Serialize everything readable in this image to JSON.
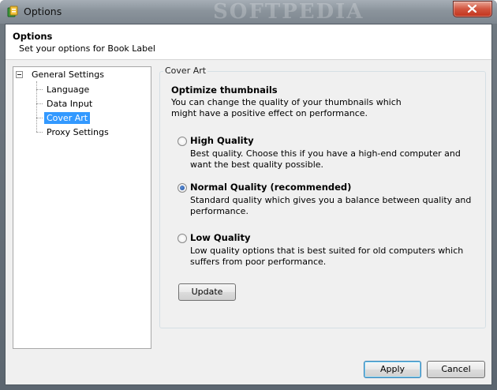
{
  "window": {
    "title": "Options",
    "watermark": "SOFTPEDIA"
  },
  "header": {
    "title": "Options",
    "subtitle": "Set your options for Book Label"
  },
  "tree": {
    "root": "General Settings",
    "items": [
      "Language",
      "Data Input",
      "Cover Art",
      "Proxy Settings"
    ],
    "selected": "Cover Art"
  },
  "panel": {
    "group_label": "Cover Art",
    "section_title": "Optimize thumbnails",
    "section_desc": "You can change the quality of your thumbnails which might have a positive effect on performance.",
    "options": [
      {
        "label": "High Quality",
        "desc": "Best quality. Choose this if you have a high-end computer and want the best quality possible.",
        "selected": false
      },
      {
        "label": "Normal Quality (recommended)",
        "desc": "Standard quality which gives you a balance between quality and performance.",
        "selected": true
      },
      {
        "label": "Low Quality",
        "desc": "Low quality options that is best suited for old computers which suffers from poor performance.",
        "selected": false
      }
    ],
    "update_label": "Update"
  },
  "footer": {
    "apply_label": "Apply",
    "cancel_label": "Cancel"
  },
  "colors": {
    "selection": "#3399ff",
    "close_button": "#c1331c",
    "titlebar": "#8b949c"
  }
}
